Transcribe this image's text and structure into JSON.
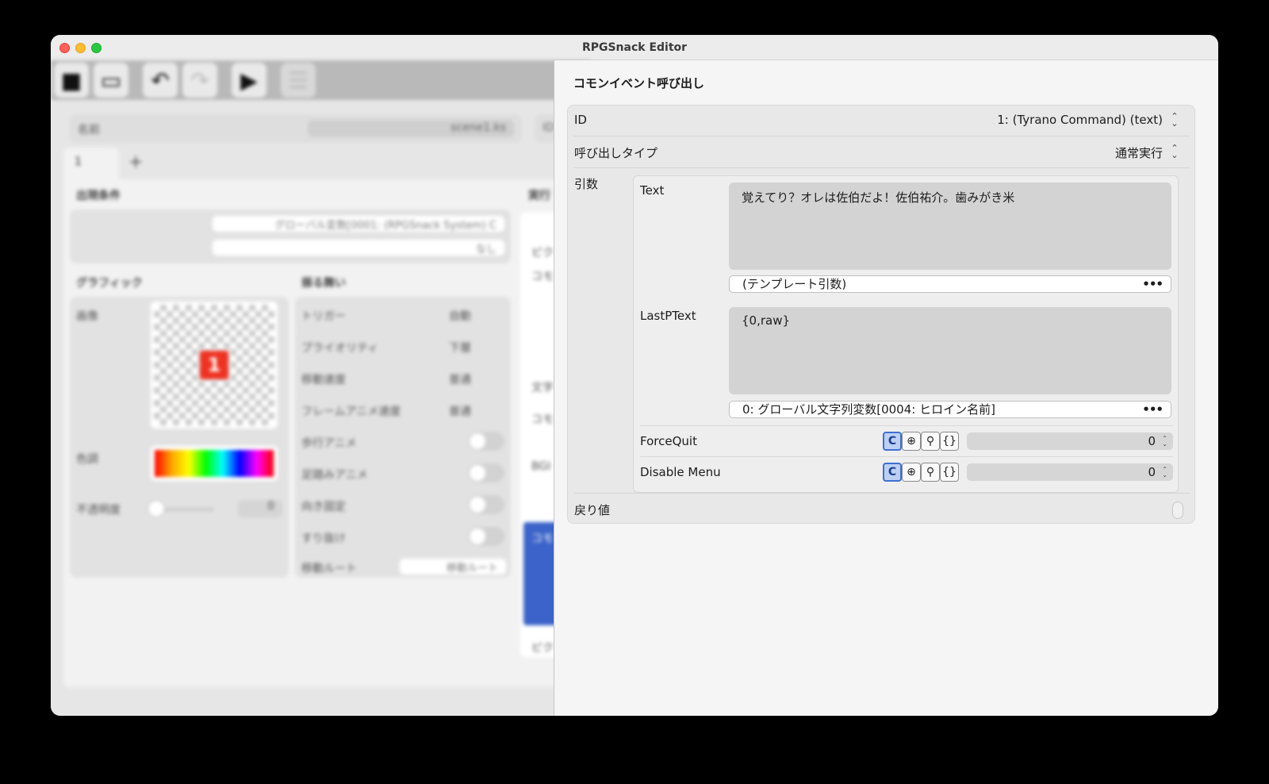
{
  "window": {
    "title": "RPGSnack Editor"
  },
  "background": {
    "name_label": "名前",
    "name_value": "scene1.ks",
    "id_label": "ID",
    "tab_label": "1",
    "tab_add": "+",
    "appear_conditions": "出現条件",
    "condition_1": "グローバル変数[0001: (RPGSnack System) C",
    "condition_2": "なし",
    "graphics": "グラフィック",
    "behavior": "振る舞い",
    "image_label": "画像",
    "badge_text": "1",
    "tint_label": "色調",
    "opacity_label": "不透明度",
    "opacity_value": "0",
    "trigger_label": "トリガー",
    "trigger_value": "自動",
    "priority_label": "プライオリティ",
    "priority_value": "下層",
    "move_speed_label": "移動速度",
    "move_speed_value": "普通",
    "frame_anim_label": "フレームアニメ速度",
    "frame_anim_value": "普通",
    "walk_anim_label": "歩行アニメ",
    "step_anim_label": "足踏みアニメ",
    "dir_fix_label": "向き固定",
    "passthrough_label": "すり抜け",
    "move_route_label": "移動ルート",
    "move_route_value": "移動ルート",
    "exec_label": "実行",
    "side_texts": [
      "ピク",
      "コモ",
      "文字",
      "コモ",
      "BGI",
      "コモ",
      "ピク"
    ]
  },
  "dialog": {
    "title": "コモンイベント呼び出し",
    "id_label": "ID",
    "id_value": "1: (Tyrano Command) (text)",
    "call_type_label": "呼び出しタイプ",
    "call_type_value": "通常実行",
    "args_label": "引数",
    "args": {
      "text_label": "Text",
      "text_value": "覚えてり？オレは佐伯だよ！佐伯祐介。歯みがき米",
      "text_template": "(テンプレート引数)",
      "lastp_label": "LastPText",
      "lastp_value": "{0,raw}",
      "lastp_template": "0: グローバル文字列変数[0004: ヒロイン名前]",
      "forcequit_label": "ForceQuit",
      "forcequit_value": "0",
      "disable_menu_label": "Disable Menu",
      "disable_menu_value": "0",
      "mode_icons": [
        "C",
        "⊕",
        "⚲",
        "{}"
      ]
    },
    "return_label": "戻り値"
  }
}
